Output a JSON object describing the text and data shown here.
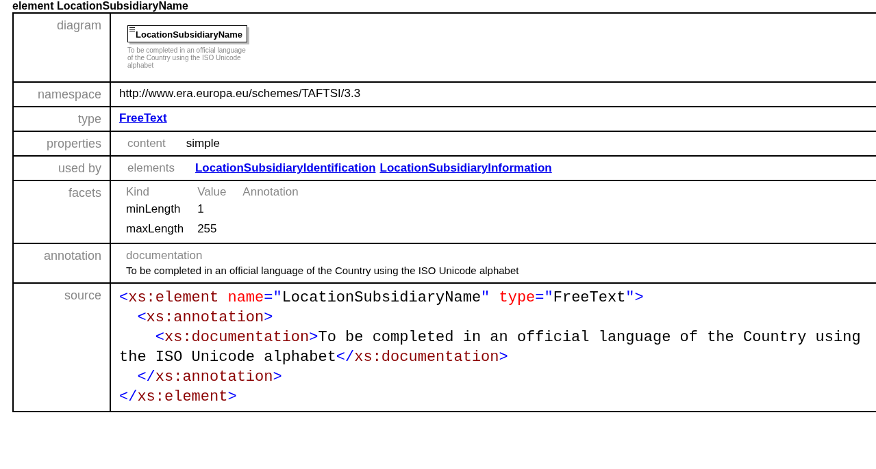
{
  "heading": "element LocationSubsidiaryName",
  "rows": [
    {
      "kind": "diagram",
      "label": "diagram",
      "element_name": "LocationSubsidiaryName",
      "description": "To be completed in an official language of the Country using the ISO Unicode alphabet"
    },
    {
      "kind": "text",
      "label": "namespace",
      "value": "http://www.era.europa.eu/schemes/TAFTSI/3.3"
    },
    {
      "kind": "link",
      "label": "type",
      "value": "FreeText"
    },
    {
      "kind": "pairs",
      "label": "properties",
      "key": "content",
      "value": "simple"
    },
    {
      "kind": "links",
      "label": "used by",
      "key": "elements",
      "links": [
        "LocationSubsidiaryIdentification",
        "LocationSubsidiaryInformation"
      ]
    },
    {
      "kind": "facets",
      "label": "facets",
      "columns": [
        "Kind",
        "Value",
        "Annotation"
      ],
      "items": [
        [
          "minLength",
          "1"
        ],
        [
          "maxLength",
          "255"
        ]
      ]
    },
    {
      "kind": "annotation",
      "label": "annotation",
      "key": "documentation",
      "value": "To be completed in an official language of the Country using the ISO Unicode alphabet"
    },
    {
      "kind": "source",
      "label": "source",
      "lines": [
        [
          {
            "kind": "punct",
            "text": "<"
          },
          {
            "kind": "tag",
            "text": "xs:element"
          },
          {
            "kind": "attr",
            "text": " name"
          },
          {
            "kind": "punct",
            "text": "=\""
          },
          {
            "kind": "value",
            "text": "LocationSubsidiaryName"
          },
          {
            "kind": "punct",
            "text": "\""
          },
          {
            "kind": "attr",
            "text": " type"
          },
          {
            "kind": "punct",
            "text": "=\""
          },
          {
            "kind": "value",
            "text": "FreeText"
          },
          {
            "kind": "punct",
            "text": "\">"
          }
        ],
        [
          {
            "kind": "punct",
            "text": "  <"
          },
          {
            "kind": "tag",
            "text": "xs:annotation"
          },
          {
            "kind": "punct",
            "text": ">"
          }
        ],
        [
          {
            "kind": "punct",
            "text": "    <"
          },
          {
            "kind": "tag",
            "text": "xs:documentation"
          },
          {
            "kind": "punct",
            "text": ">"
          },
          {
            "kind": "value",
            "text": "To be completed in an official language of the Country using the ISO Unicode alphabet"
          },
          {
            "kind": "punct",
            "text": "</"
          },
          {
            "kind": "tag",
            "text": "xs:documentation"
          },
          {
            "kind": "punct",
            "text": ">"
          }
        ],
        [
          {
            "kind": "punct",
            "text": "  </"
          },
          {
            "kind": "tag",
            "text": "xs:annotation"
          },
          {
            "kind": "punct",
            "text": ">"
          }
        ],
        [
          {
            "kind": "punct",
            "text": "</"
          },
          {
            "kind": "tag",
            "text": "xs:element"
          },
          {
            "kind": "punct",
            "text": ">"
          }
        ]
      ]
    }
  ]
}
